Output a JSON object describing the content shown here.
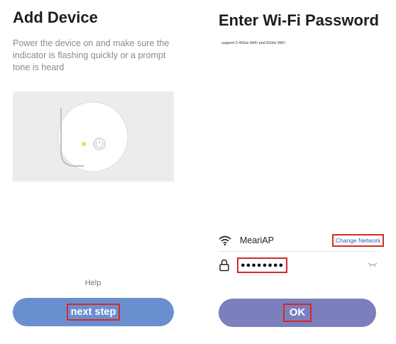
{
  "left": {
    "title": "Add Device",
    "description": "Power the device on and make sure the indicator is flashing quickly or a prompt tone is heard",
    "help_label": "Help",
    "next_button_label": "next step",
    "illustration_icon": "device-power-indicator-icon"
  },
  "right": {
    "title": "Enter Wi-Fi Password",
    "support_note": "support 2.4GHz WiFi and 5GHz WiFi",
    "wifi_name": "MeariAP",
    "change_network_label": "Change Network",
    "password_value": "●●●●●●●●",
    "ok_button_label": "OK",
    "icons": {
      "wifi": "wifi-icon",
      "lock": "lock-icon",
      "visibility": "eye-closed-icon"
    }
  },
  "colors": {
    "next_button": "#6a8fd0",
    "ok_button": "#7b7fbc",
    "highlight_box": "#d62828",
    "link": "#3d5aa8",
    "indicator_led": "#f0de4a"
  }
}
